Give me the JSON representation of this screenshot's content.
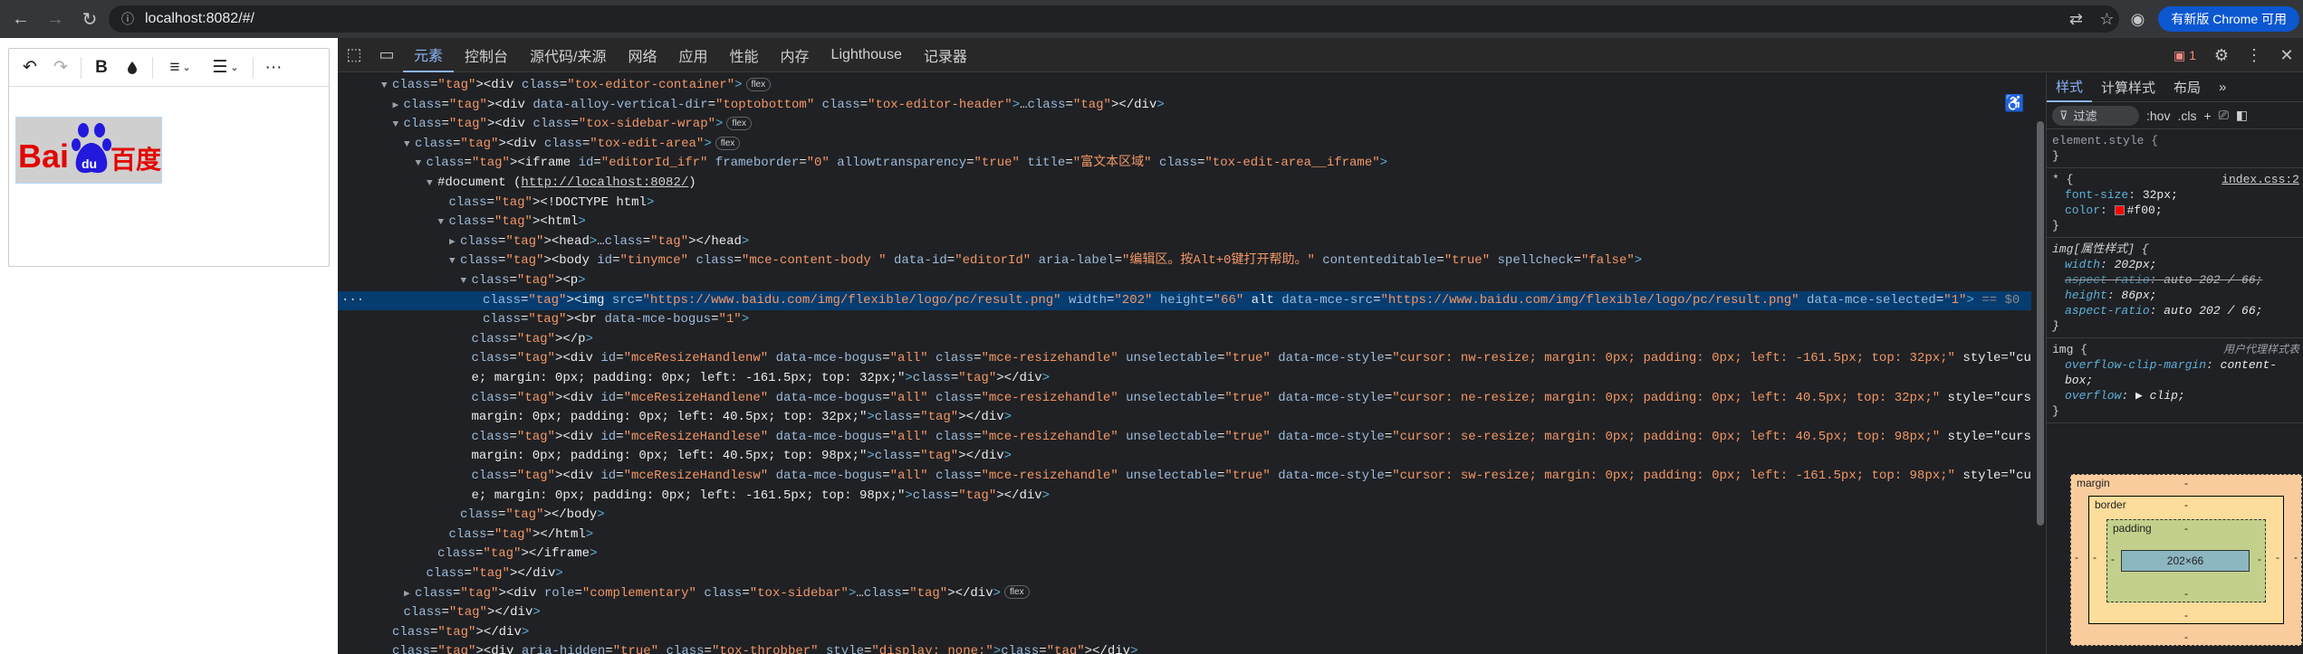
{
  "browser": {
    "url": "localhost:8082/#/",
    "update_label": "有新版 Chrome 可用"
  },
  "editor": {
    "toolbar": {
      "undo_icon": "undo-icon",
      "redo_icon": "redo-icon",
      "bold_label": "B",
      "more_label": "···"
    },
    "logo_text": "Bai",
    "logo_text2": "百度",
    "colors": {
      "logo_red": "#e10601",
      "logo_blue": "#2319dc"
    }
  },
  "devtools": {
    "tabs": [
      "元素",
      "控制台",
      "源代码/来源",
      "网络",
      "应用",
      "性能",
      "内存",
      "Lighthouse",
      "记录器"
    ],
    "active_tab": "元素",
    "issues_count": "1",
    "tree_rows": [
      {
        "text": "<div class=\"tox-editor-container\">",
        "badge": "flex"
      },
      {
        "text": "<div data-alloy-vertical-dir=\"toptobottom\" class=\"tox-editor-header\">…</div>"
      },
      {
        "text": "<div class=\"tox-sidebar-wrap\">",
        "badge": "flex"
      },
      {
        "text": "<div class=\"tox-edit-area\">",
        "badge": "flex"
      },
      {
        "text": "<iframe id=\"editorId_ifr\" frameborder=\"0\" allowtransparency=\"true\" title=\"富文本区域\" class=\"tox-edit-area__iframe\">"
      },
      {
        "text": "#document (http://localhost:8082/)"
      },
      {
        "text": "<!DOCTYPE html>"
      },
      {
        "text": "<html>"
      },
      {
        "text": "<head>…</head>"
      },
      {
        "text": "<body id=\"tinymce\" class=\"mce-content-body \" data-id=\"editorId\" aria-label=\"编辑区。按Alt+0键打开帮助。\" contenteditable=\"true\" spellcheck=\"false\">"
      },
      {
        "text": "<p>"
      },
      {
        "text": "<img src=\"https://www.baidu.com/img/flexible/logo/pc/result.png\" width=\"202\" height=\"66\" alt data-mce-src=\"https://www.baidu.com/img/flexible/logo/pc/result.png\" data-mce-selected=\"1\"> == $0"
      },
      {
        "text": "<br data-mce-bogus=\"1\">"
      },
      {
        "text": "</p>"
      },
      {
        "text": "<div id=\"mceResizeHandlenw\" data-mce-bogus=\"all\" class=\"mce-resizehandle\" unselectable=\"true\" data-mce-style=\"cursor: nw-resize; margin: 0px; padding: 0px; left: -161.5px; top: 32px;\" style=\"cursor: nw-resiz"
      },
      {
        "text": "e; margin: 0px; padding: 0px; left: -161.5px; top: 32px;\"></div>"
      },
      {
        "text": "<div id=\"mceResizeHandlene\" data-mce-bogus=\"all\" class=\"mce-resizehandle\" unselectable=\"true\" data-mce-style=\"cursor: ne-resize; margin: 0px; padding: 0px; left: 40.5px; top: 32px;\" style=\"cursor: ne-resize;"
      },
      {
        "text": "margin: 0px; padding: 0px; left: 40.5px; top: 32px;\"></div>"
      },
      {
        "text": "<div id=\"mceResizeHandlese\" data-mce-bogus=\"all\" class=\"mce-resizehandle\" unselectable=\"true\" data-mce-style=\"cursor: se-resize; margin: 0px; padding: 0px; left: 40.5px; top: 98px;\" style=\"cursor: se-resize;"
      },
      {
        "text": "margin: 0px; padding: 0px; left: 40.5px; top: 98px;\"></div>"
      },
      {
        "text": "<div id=\"mceResizeHandlesw\" data-mce-bogus=\"all\" class=\"mce-resizehandle\" unselectable=\"true\" data-mce-style=\"cursor: sw-resize; margin: 0px; padding: 0px; left: -161.5px; top: 98px;\" style=\"cursor: sw-resiz"
      },
      {
        "text": "e; margin: 0px; padding: 0px; left: -161.5px; top: 98px;\"></div>"
      },
      {
        "text": "</body>"
      },
      {
        "text": "</html>"
      },
      {
        "text": "</iframe>"
      },
      {
        "text": "</div>"
      },
      {
        "text": "<div role=\"complementary\" class=\"tox-sidebar\">…</div>",
        "badge": "flex"
      },
      {
        "text": "</div>"
      },
      {
        "text": "</div>"
      },
      {
        "text": "<div aria-hidden=\"true\" class=\"tox-throbber\" style=\"display: none;\"></div>"
      }
    ],
    "styles": {
      "tabs": [
        "样式",
        "计算样式",
        "布局"
      ],
      "filter_placeholder": "过滤",
      "hov": ":hov",
      "cls": ".cls",
      "element_style": "element.style {",
      "rule1_selector": "* {",
      "rule1_source": "index.css:2",
      "rule1_props": [
        [
          "font-size",
          "32px;"
        ],
        [
          "color",
          "#f00;"
        ]
      ],
      "rule2_selector": "img[属性样式] {",
      "rule2_props": [
        [
          "width",
          "202px;"
        ],
        [
          "aspect-ratio",
          "auto 202 / 66;"
        ],
        [
          "height",
          "86px;"
        ],
        [
          "aspect-ratio",
          "auto 202 / 66;"
        ]
      ],
      "rule3_selector": "img {",
      "rule3_source": "用户代理样式表",
      "rule3_props": [
        [
          "overflow-clip-margin",
          "content-box;"
        ],
        [
          "overflow",
          "▶ clip;"
        ]
      ],
      "box_model": {
        "margin_label": "margin",
        "border_label": "border",
        "padding_label": "padding",
        "content_size": "202×66",
        "dash": "-"
      }
    }
  }
}
